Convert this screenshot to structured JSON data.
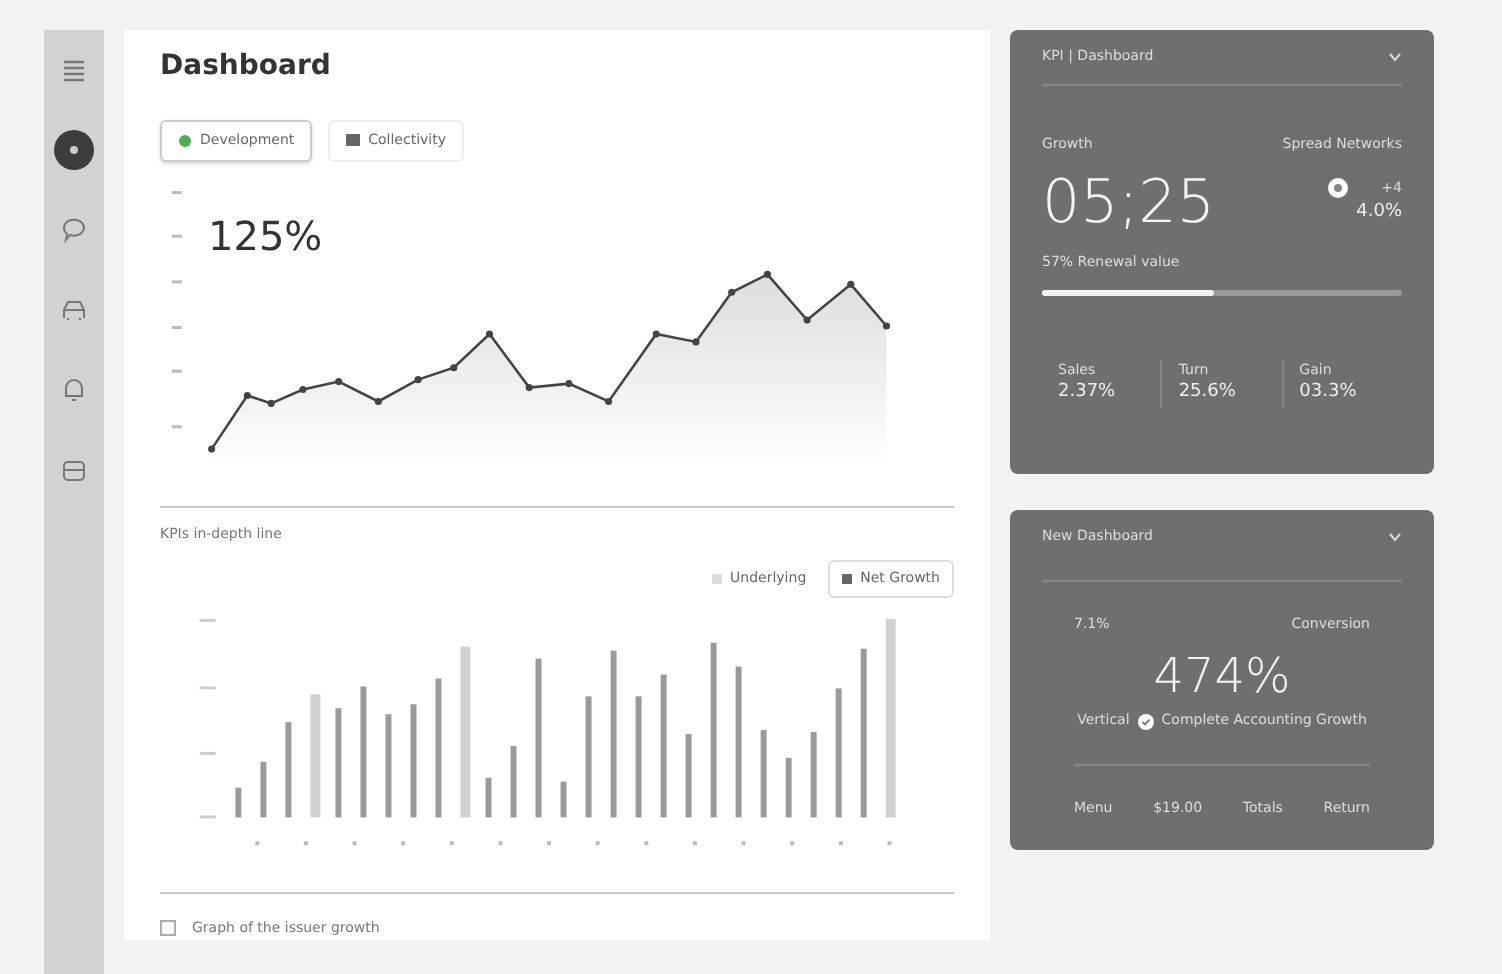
{
  "sidebar": {
    "items": [
      {
        "kind": "menu",
        "selected": false
      },
      {
        "kind": "user",
        "selected": true
      },
      {
        "kind": "chat",
        "selected": false
      },
      {
        "kind": "car",
        "selected": false
      },
      {
        "kind": "bell",
        "selected": false
      },
      {
        "kind": "box",
        "selected": false
      }
    ]
  },
  "main": {
    "title": "Dashboard",
    "tabs": [
      {
        "label": "Development",
        "kind": "dot",
        "selected": true
      },
      {
        "label": "Collectivity",
        "kind": "grid",
        "selected": false
      }
    ],
    "headline": "125%",
    "bars_title": "KPIs in-depth line",
    "legend": [
      {
        "label": "Underlying",
        "selected": false
      },
      {
        "label": "Net Growth",
        "selected": true
      }
    ],
    "footer": {
      "label": "Graph of the issuer growth",
      "checked": false
    }
  },
  "kpi_card": {
    "title": "KPI | Dashboard",
    "left_label": "Growth",
    "right_label": "Spread Networks",
    "value": "05;25",
    "badge": {
      "label": "+4",
      "value": "4.0%"
    },
    "progress": {
      "label": "57% Renewal value",
      "level": 0.48
    },
    "stats": [
      {
        "label": "Sales",
        "value": "2.37%"
      },
      {
        "label": "Turn",
        "value": "25.6%"
      },
      {
        "label": "Gain",
        "value": "03.3%"
      }
    ]
  },
  "new_card": {
    "title": "New Dashboard",
    "left_label": "7.1%",
    "right_label": "Conversion",
    "value": "474%",
    "note": {
      "prefix": "Vertical",
      "text": "Complete Accounting Growth"
    },
    "footer": [
      "Menu",
      "$19.00",
      "Totals",
      "Return"
    ]
  }
}
